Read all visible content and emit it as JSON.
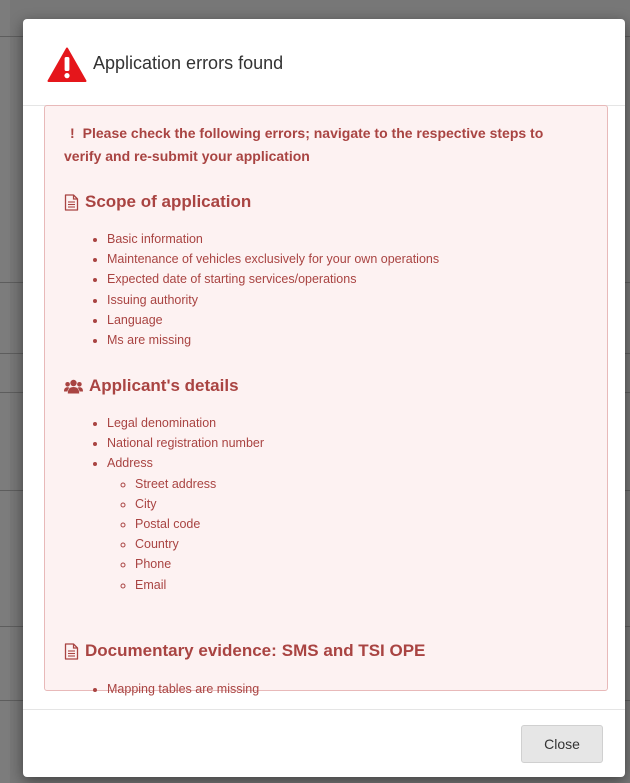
{
  "modal": {
    "title": "Application errors found",
    "icon": "warning-triangle-icon",
    "intro_mark": "!",
    "intro": "Please check the following errors; navigate to the respective steps to verify and re-submit your application",
    "sections": {
      "scope": {
        "icon": "document-icon",
        "title": "Scope of application",
        "items": [
          "Basic information",
          "Maintenance of vehicles exclusively for your own operations",
          "Expected date of starting services/operations",
          "Issuing authority",
          "Language",
          "Ms are missing"
        ]
      },
      "applicant": {
        "icon": "users-icon",
        "title": "Applicant's details",
        "items": [
          "Legal denomination",
          "National registration number",
          "Address"
        ],
        "address_items": [
          "Street address",
          "City",
          "Postal code",
          "Country",
          "Phone",
          "Email"
        ]
      },
      "evidence": {
        "icon": "document-icon",
        "title": "Documentary evidence:",
        "title_strong": "SMS and TSI OPE",
        "items": [
          "Mapping tables are missing"
        ]
      }
    },
    "close_label": "Close"
  },
  "colors": {
    "error_text": "#a94442",
    "alert_background": "#fdf2f2",
    "alert_border": "#e8b9b9",
    "warning_red": "#e5161b"
  }
}
